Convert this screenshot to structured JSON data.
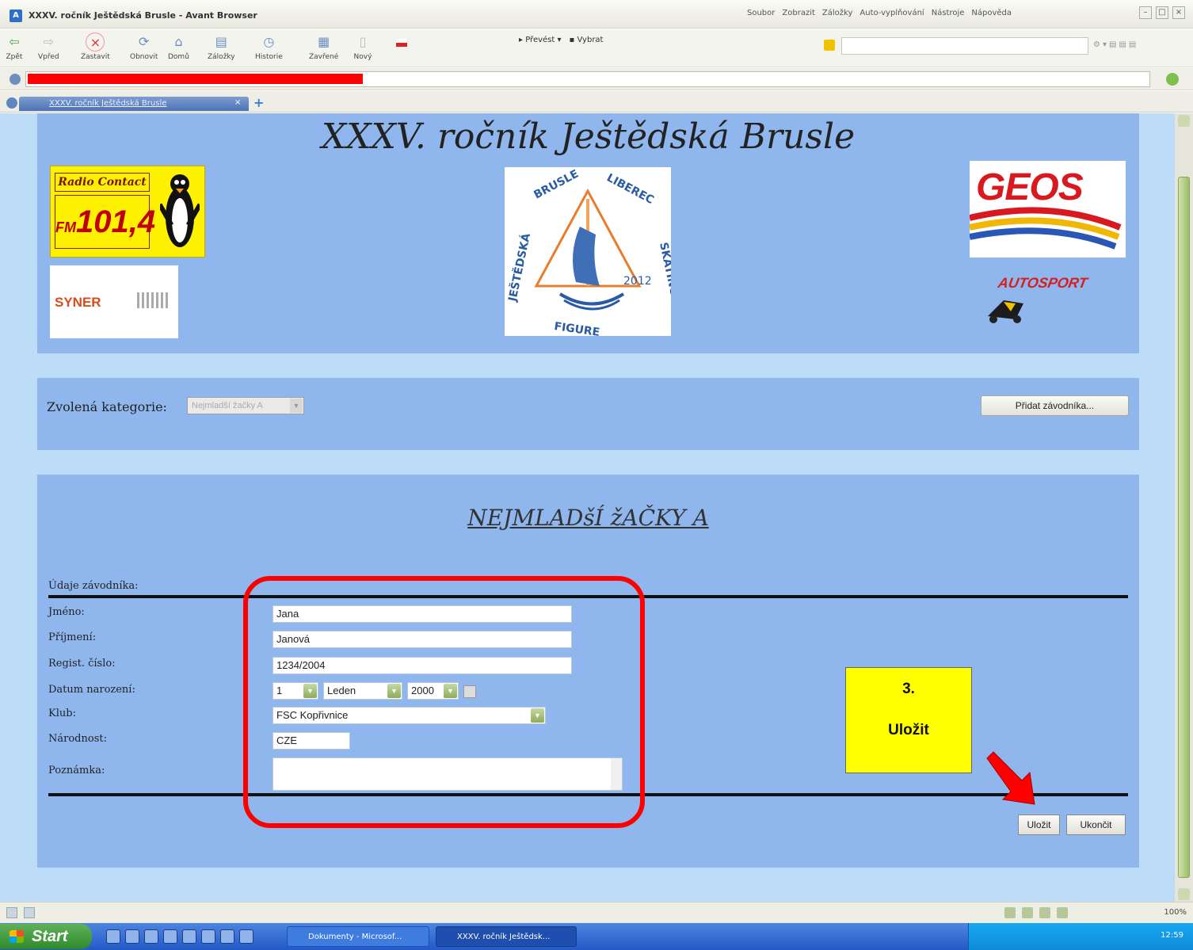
{
  "window": {
    "title": "XXXV. ročník Ještědská Brusle - Avant Browser",
    "app_icon": "A",
    "menu": [
      "Soubor",
      "Zobrazit",
      "Záložky",
      "Auto-vyplňování",
      "Nástroje",
      "Nápověda"
    ]
  },
  "toolbar": {
    "buttons": [
      {
        "label": "Zpět",
        "icon": "back-arrow-icon"
      },
      {
        "label": "Vpřed",
        "icon": "forward-arrow-icon"
      },
      {
        "label": "Zastavit",
        "icon": "stop-icon"
      },
      {
        "label": "Obnovit",
        "icon": "refresh-icon"
      },
      {
        "label": "Domů",
        "icon": "home-icon"
      },
      {
        "label": "Záložky",
        "icon": "bookmarks-icon"
      },
      {
        "label": "Historie",
        "icon": "history-icon"
      },
      {
        "label": "Zavřené",
        "icon": "closed-tabs-icon"
      },
      {
        "label": "Nový",
        "icon": "new-page-icon"
      }
    ],
    "convert_label": "Převést",
    "select_label": "Vybrat"
  },
  "tabs": [
    {
      "label": "XXXV. ročník Ještědská Brusle",
      "active": true
    }
  ],
  "page": {
    "title": "XXXV. ročník Ještědská Brusle",
    "sponsors": {
      "radio_line1": "Radio Contact",
      "radio_fm": "FM",
      "radio_freq": "101,4",
      "syner": "SYNER",
      "geos": "GEOS",
      "autosport": "AUTOSPORT"
    },
    "center_logo": {
      "top_text": "BRUSLE",
      "top_right": "LIBEREC",
      "left_text": "JEŠTĚDSKÁ",
      "right_text": "SKATING",
      "bottom_text": "FIGURE",
      "year": "2012"
    },
    "category": {
      "label": "Zvolená kategorie:",
      "selected": "Nejmladší žačky A",
      "add_button": "Přidat závodníka..."
    },
    "form": {
      "heading": "NEJMLADšÍ žAČKY A",
      "section_label": "Údaje závodníka:",
      "fields": {
        "first_name_label": "Jméno:",
        "first_name": "Jana",
        "last_name_label": "Příjmení:",
        "last_name": "Janová",
        "reg_label": "Regist. číslo:",
        "reg_number": "1234/2004",
        "dob_label": "Datum narození:",
        "dob_day": "1",
        "dob_month": "Leden",
        "dob_year": "2000",
        "club_label": "Klub:",
        "club": "FSC Kopřivnice",
        "nationality_label": "Národnost:",
        "nationality": "CZE",
        "note_label": "Poznámka:",
        "note": ""
      },
      "save_button": "Uložit",
      "close_button": "Ukončit"
    }
  },
  "annotation": {
    "step": "3.",
    "text": "Uložit",
    "highlight_color": "#ff0000",
    "callout_color": "#ffff00"
  },
  "statusbar": {
    "zoom": "100%"
  },
  "taskbar": {
    "start_label": "Start",
    "tasks": [
      "Dokumenty - Microsof...",
      "XXXV. ročník Ještědsk..."
    ],
    "clock": "12:59"
  }
}
